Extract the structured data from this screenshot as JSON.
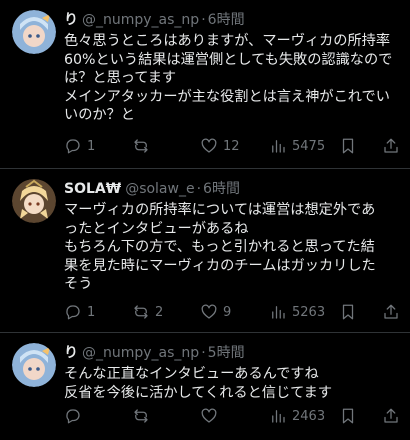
{
  "tweets": [
    {
      "name": "り",
      "handle": "@_numpy_as_np",
      "dot": "·",
      "time": "6時間",
      "lines": [
        "色々思うところはありますが、マーヴィカの所持率",
        "60%という結果は運営側としても失敗の認識なので",
        "は？と思ってます",
        "メインアタッカーが主な役割とは言え神がこれでい",
        "いのか？と"
      ],
      "actions": {
        "replies": "1",
        "retweets": "",
        "likes": "12",
        "views": "5475"
      }
    },
    {
      "name": "SOLA₩",
      "handle": "@solaw_e",
      "dot": "·",
      "time": "6時間",
      "lines": [
        "マーヴィカの所持率については運営は想定外であ",
        "ったとインタビューがあるね",
        "もちろん下の方で、もっと引かれると思ってた結",
        "果を見た時にマーヴィカのチームはガッカリした",
        "そう"
      ],
      "actions": {
        "replies": "1",
        "retweets": "2",
        "likes": "9",
        "views": "5263"
      }
    },
    {
      "name": "り",
      "handle": "@_numpy_as_np",
      "dot": "·",
      "time": "5時間",
      "lines": [
        "そんな正直なインタビューあるんですね",
        "反省を今後に活かしてくれると信じてます"
      ],
      "actions": {
        "replies": "",
        "retweets": "",
        "likes": "",
        "views": "2463"
      }
    }
  ],
  "colors": {
    "background": "#000000",
    "text": "#e7e9ea",
    "muted": "#71767b",
    "divider": "#2f3336"
  },
  "icons": [
    "reply-icon",
    "retweet-icon",
    "like-icon",
    "views-icon",
    "bookmark-icon",
    "share-icon"
  ]
}
